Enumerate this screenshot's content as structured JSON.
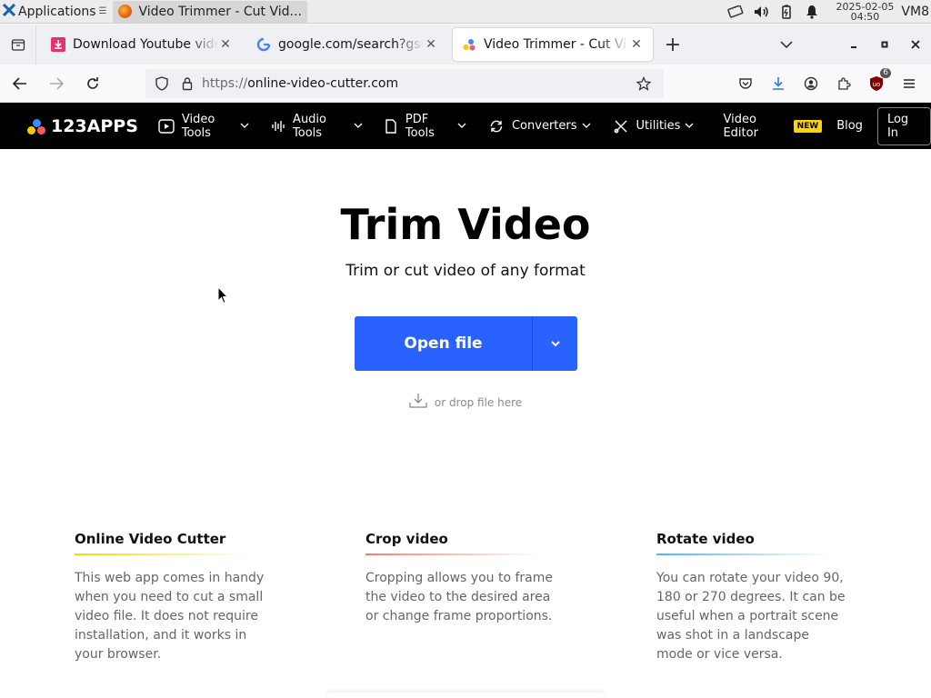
{
  "taskbar": {
    "apps_label": "Applications",
    "window_title": "Video Trimmer - Cut Vid...",
    "date": "2025-02-05",
    "time": "04:50",
    "vm_label": "VM8"
  },
  "tabs": [
    {
      "title": "Download Youtube videos",
      "favicon": "download-favicon"
    },
    {
      "title": "google.com/search?gsessionid",
      "favicon": "google-favicon"
    },
    {
      "title": "Video Trimmer - Cut Video",
      "favicon": "123apps-favicon",
      "active": true
    }
  ],
  "url": {
    "protocol": "https://",
    "host": "online-video-cutter.com"
  },
  "extension_badge": "6",
  "site": {
    "logo": "123APPS",
    "menu": [
      {
        "label": "Video Tools",
        "icon": "play-icon"
      },
      {
        "label": "Audio Tools",
        "icon": "waveform-icon"
      },
      {
        "label": "PDF Tools",
        "icon": "document-icon"
      },
      {
        "label": "Converters",
        "icon": "convert-icon"
      },
      {
        "label": "Utilities",
        "icon": "tools-icon"
      }
    ],
    "video_editor": "Video Editor",
    "new_badge": "NEW",
    "blog": "Blog",
    "login": "Log In"
  },
  "hero": {
    "title": "Trim Video",
    "subtitle": "Trim or cut video of any format",
    "open_button": "Open file",
    "drop_hint": "or drop file here"
  },
  "features": [
    {
      "title": "Online Video Cutter",
      "text": "This web app comes in handy when you need to cut a small video file. It does not require installation, and it works in your browser."
    },
    {
      "title": "Crop video",
      "text": "Cropping allows you to frame the video to the desired area or change frame proportions."
    },
    {
      "title": "Rotate video",
      "text": "You can rotate your video 90, 180 or 270 degrees. It can be useful when a portrait scene was shot in a landscape mode or vice versa."
    }
  ],
  "colors": {
    "accent": "#2a62ff",
    "site_bar": "#000000",
    "new_badge": "#ffd400"
  }
}
